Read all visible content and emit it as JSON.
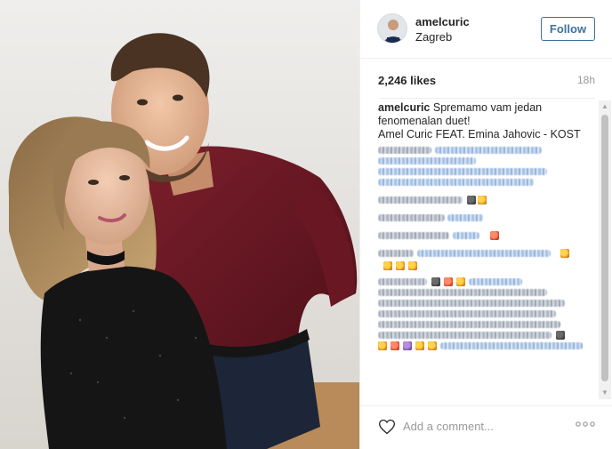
{
  "post": {
    "username": "amelcuric",
    "location": "Zagreb",
    "follow_label": "Follow",
    "likes": "2,246 likes",
    "time": "18h"
  },
  "caption": {
    "user": "amelcuric",
    "line1": "Spremamo vam jedan",
    "line2": "fenomenalan duet!",
    "line3": "Amel Curic FEAT. Emina Jahovic - KOST"
  },
  "comment_box": {
    "placeholder": "Add a comment..."
  },
  "icons": {
    "like": "heart-icon",
    "more": "more-options-icon",
    "avatar": "avatar"
  },
  "colors": {
    "follow_blue": "#3f729b",
    "text": "#262626",
    "muted": "#999999",
    "divider": "#efefef"
  }
}
